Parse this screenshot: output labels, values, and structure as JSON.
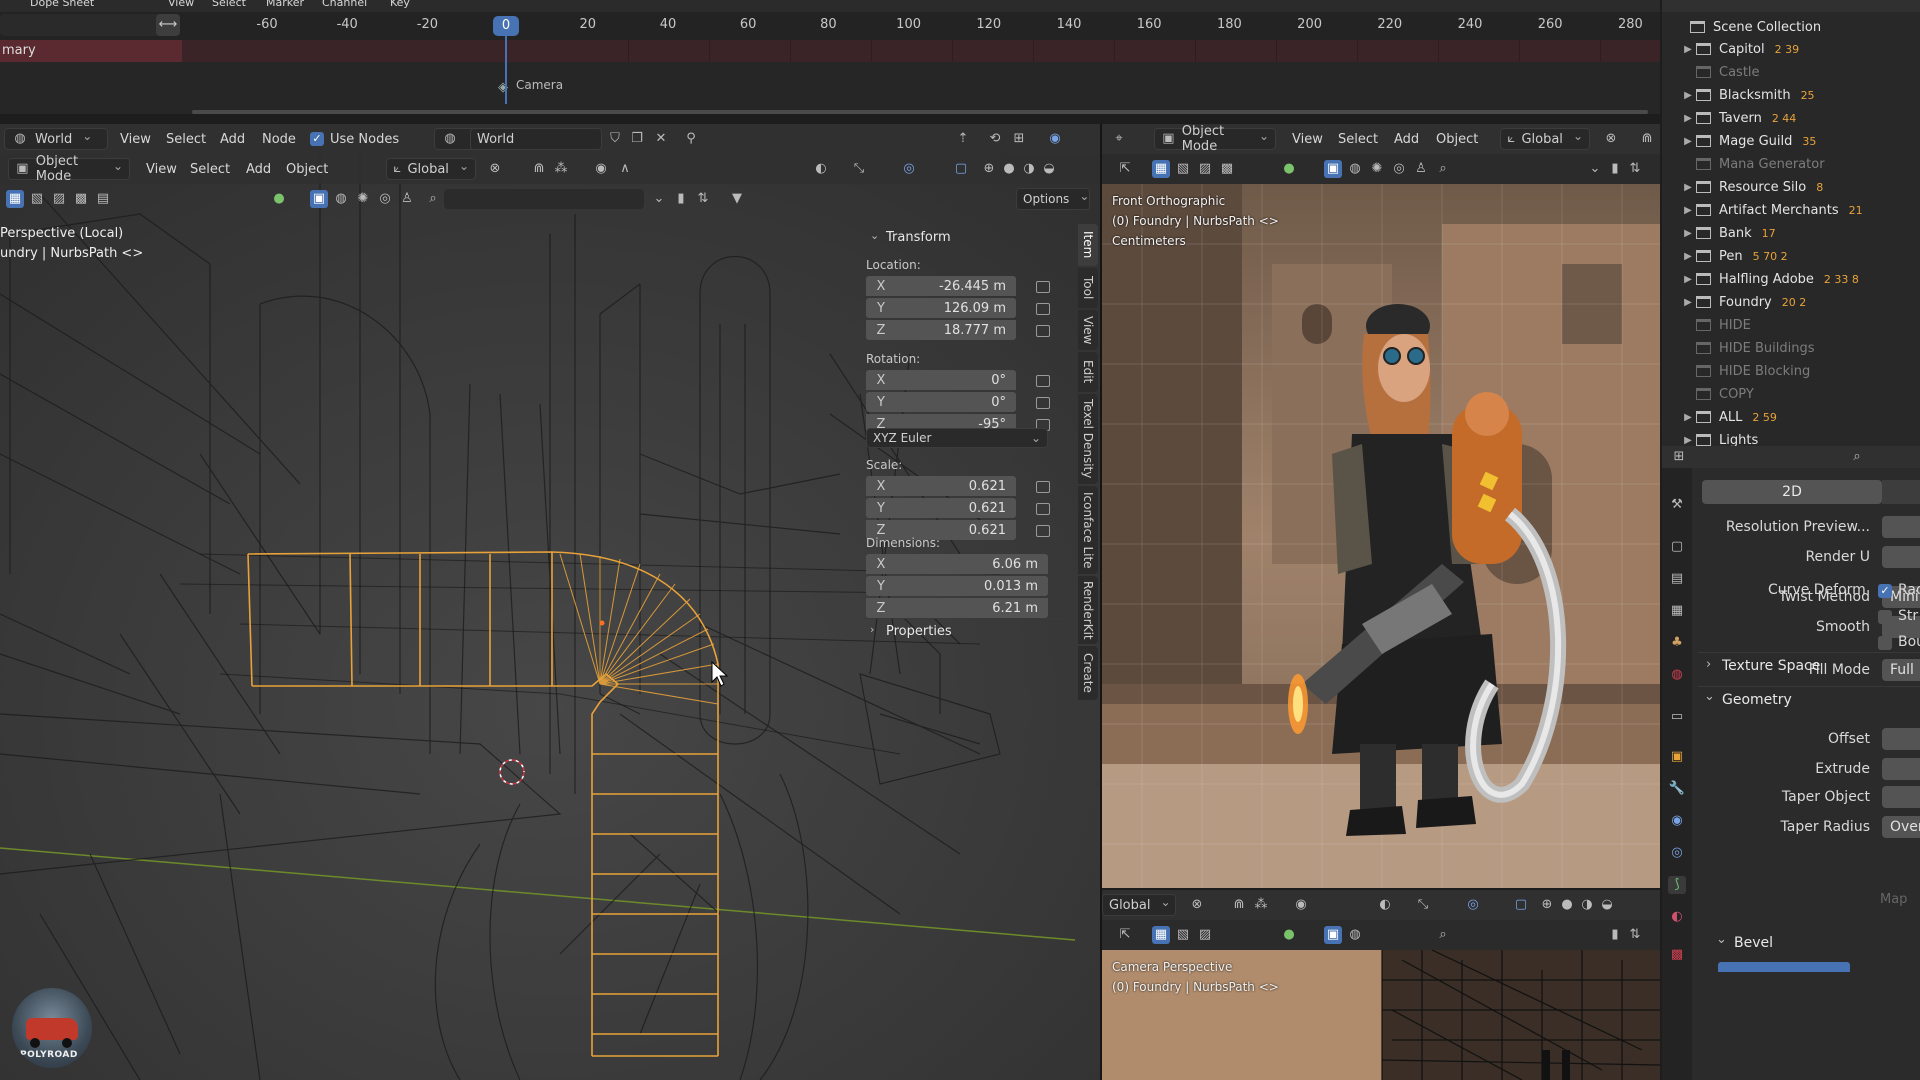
{
  "dopesheet": {
    "editor_label": "Dope Sheet",
    "menu": [
      "View",
      "Select",
      "Marker",
      "Channel",
      "Key"
    ],
    "ticks": [
      "-60",
      "-40",
      "-20",
      "0",
      "20",
      "40",
      "60",
      "80",
      "100",
      "120",
      "140",
      "160",
      "180",
      "200",
      "220",
      "240",
      "260",
      "280"
    ],
    "current_frame": "0",
    "channel": "mary",
    "marker": "Camera"
  },
  "node_editor": {
    "world_dropdown": "World",
    "menu": [
      "View",
      "Select",
      "Add",
      "Node"
    ],
    "use_nodes_label": "Use Nodes",
    "world_name": "World"
  },
  "viewport_left": {
    "mode": "Object Mode",
    "menu": [
      "View",
      "Select",
      "Add",
      "Object"
    ],
    "orientation": "Global",
    "options_label": "Options",
    "overlay_line1": "Perspective (Local)",
    "overlay_line2": "undry | NurbsPath <>",
    "logo_text": "POLYROAD"
  },
  "n_panel": {
    "transform_label": "Transform",
    "location_label": "Location:",
    "location": [
      {
        "axis": "X",
        "value": "-26.445 m"
      },
      {
        "axis": "Y",
        "value": "126.09 m"
      },
      {
        "axis": "Z",
        "value": "18.777 m"
      }
    ],
    "rotation_label": "Rotation:",
    "rotation": [
      {
        "axis": "X",
        "value": "0°"
      },
      {
        "axis": "Y",
        "value": "0°"
      },
      {
        "axis": "Z",
        "value": "-95°"
      }
    ],
    "rotation_mode": "XYZ Euler",
    "scale_label": "Scale:",
    "scale": [
      {
        "axis": "X",
        "value": "0.621"
      },
      {
        "axis": "Y",
        "value": "0.621"
      },
      {
        "axis": "Z",
        "value": "0.621"
      }
    ],
    "dimensions_label": "Dimensions:",
    "dimensions": [
      {
        "axis": "X",
        "value": "6.06 m"
      },
      {
        "axis": "Y",
        "value": "0.013 m"
      },
      {
        "axis": "Z",
        "value": "6.21 m"
      }
    ],
    "properties_label": "Properties",
    "tabs": [
      "Item",
      "Tool",
      "View",
      "Edit",
      "Texel Density",
      "Iconface Lite",
      "RenderKit",
      "Create"
    ]
  },
  "viewport_right_top": {
    "mode": "Object Mode",
    "menu": [
      "View",
      "Select",
      "Add",
      "Object"
    ],
    "orientation": "Global",
    "overlay_line1": "Front Orthographic",
    "overlay_line2": "(0) Foundry | NurbsPath <>",
    "overlay_line3": "Centimeters"
  },
  "viewport_right_bottom": {
    "orientation": "Global",
    "overlay_line1": "Camera Perspective",
    "overlay_line2": "(0) Foundry | NurbsPath <>"
  },
  "outliner": {
    "root": "Scene Collection",
    "items": [
      {
        "name": "Capitol",
        "badges": "2 39",
        "expandable": true,
        "dim": false
      },
      {
        "name": "Castle",
        "badges": "",
        "expandable": false,
        "dim": true
      },
      {
        "name": "Blacksmith",
        "badges": "25",
        "expandable": true,
        "dim": false
      },
      {
        "name": "Tavern",
        "badges": "2 44",
        "expandable": true,
        "dim": false
      },
      {
        "name": "Mage Guild",
        "badges": "35",
        "expandable": true,
        "dim": false
      },
      {
        "name": "Mana Generator",
        "badges": "",
        "expandable": false,
        "dim": true
      },
      {
        "name": "Resource Silo",
        "badges": "8",
        "expandable": true,
        "dim": false
      },
      {
        "name": "Artifact Merchants",
        "badges": "21",
        "expandable": true,
        "dim": false
      },
      {
        "name": "Bank",
        "badges": "17",
        "expandable": true,
        "dim": false
      },
      {
        "name": "Pen",
        "badges": "5 70 2",
        "expandable": true,
        "dim": false
      },
      {
        "name": "Halfling Adobe",
        "badges": "2 33 8",
        "expandable": true,
        "dim": false
      },
      {
        "name": "Foundry",
        "badges": "20 2",
        "expandable": true,
        "dim": false
      },
      {
        "name": "HIDE",
        "badges": "",
        "expandable": false,
        "dim": true
      },
      {
        "name": "HIDE Buildings",
        "badges": "",
        "expandable": false,
        "dim": true
      },
      {
        "name": "HIDE Blocking",
        "badges": "",
        "expandable": false,
        "dim": true
      },
      {
        "name": "COPY",
        "badges": "",
        "expandable": false,
        "dim": true
      },
      {
        "name": "ALL",
        "badges": "2 59",
        "expandable": true,
        "dim": false
      },
      {
        "name": "Lights",
        "badges": "",
        "expandable": true,
        "dim": false
      }
    ]
  },
  "properties": {
    "mode_2d": "2D",
    "rows": [
      {
        "label": "Resolution Preview...",
        "value": ""
      },
      {
        "label": "Render U",
        "value": ""
      },
      {
        "label": "Twist Method",
        "value": "Minim"
      },
      {
        "label": "Smooth",
        "value": ""
      },
      {
        "label": "Fill Mode",
        "value": "Full"
      }
    ],
    "curve_deform_label": "Curve Deform",
    "checkboxes": [
      {
        "label": "Rad",
        "checked": true
      },
      {
        "label": "Str",
        "checked": false
      },
      {
        "label": "Bou",
        "checked": false
      }
    ],
    "texture_space_label": "Texture Space",
    "geometry_label": "Geometry",
    "geometry_rows": [
      {
        "label": "Offset",
        "value": ""
      },
      {
        "label": "Extrude",
        "value": ""
      },
      {
        "label": "Taper Object",
        "value": ""
      },
      {
        "label": "Taper Radius",
        "value": "Overr"
      }
    ],
    "map_label": "Map",
    "bevel_label": "Bevel"
  },
  "colors": {
    "accent_blue": "#4772b3",
    "selection_orange": "#e8a23a",
    "active_outline": "#f5a623"
  }
}
